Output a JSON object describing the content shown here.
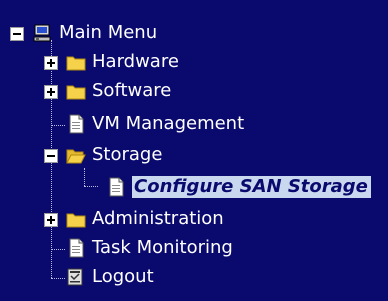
{
  "tree": {
    "root": {
      "label": "Main Menu",
      "icon": "computer-icon",
      "expanded": true
    },
    "items": [
      {
        "label": "Hardware",
        "icon": "folder-icon",
        "type": "folder",
        "expanded": false
      },
      {
        "label": "Software",
        "icon": "folder-icon",
        "type": "folder",
        "expanded": false
      },
      {
        "label": "VM Management",
        "icon": "document-icon",
        "type": "page"
      },
      {
        "label": "Storage",
        "icon": "open-folder-icon",
        "type": "folder",
        "expanded": true,
        "children": [
          {
            "label": "Configure SAN Storage",
            "icon": "document-icon",
            "type": "page",
            "selected": true
          }
        ]
      },
      {
        "label": "Administration",
        "icon": "folder-icon",
        "type": "folder",
        "expanded": false
      },
      {
        "label": "Task Monitoring",
        "icon": "document-icon",
        "type": "page"
      },
      {
        "label": "Logout",
        "icon": "logout-icon",
        "type": "page"
      }
    ]
  },
  "colors": {
    "background": "#0a0a6e",
    "text": "#ffffff",
    "selected_bg": "#c9d8ee",
    "selected_text": "#0a0a6e",
    "folder": "#f6d24a"
  }
}
